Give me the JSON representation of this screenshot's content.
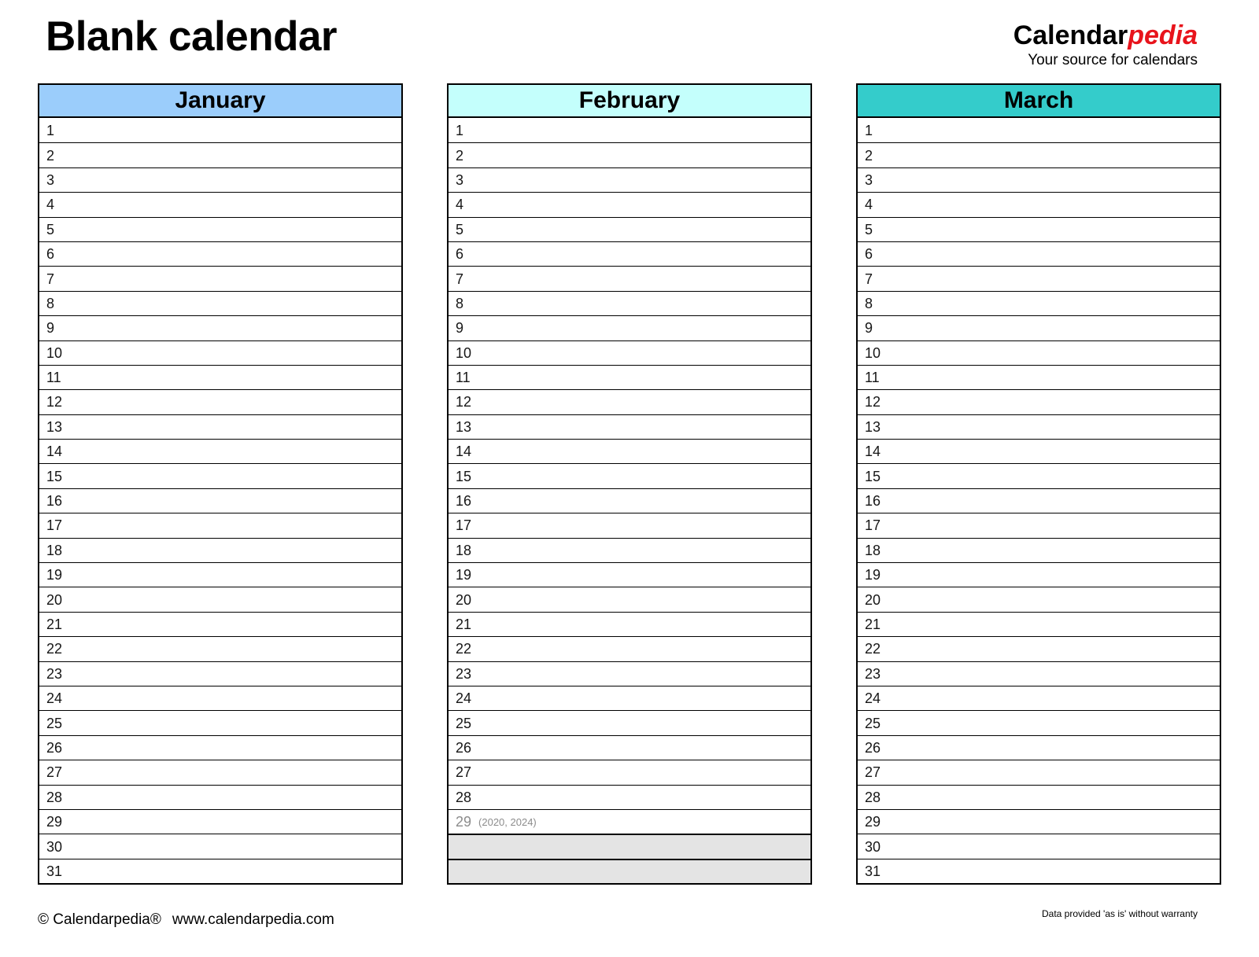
{
  "header": {
    "title": "Blank calendar",
    "brand_black": "Calendar",
    "brand_red": "pedia",
    "brand_tagline": "Your source for calendars"
  },
  "colors": {
    "january_header": "#9BCDFB",
    "february_header": "#C4FFFC",
    "march_header": "#34CCCB",
    "blank_row": "#E4E4E4",
    "brand_red": "#E8141C",
    "grid": "#000000"
  },
  "months": [
    {
      "name": "January",
      "header_color": "#9BCDFB",
      "days": [
        {
          "num": "1"
        },
        {
          "num": "2"
        },
        {
          "num": "3"
        },
        {
          "num": "4"
        },
        {
          "num": "5"
        },
        {
          "num": "6"
        },
        {
          "num": "7"
        },
        {
          "num": "8"
        },
        {
          "num": "9"
        },
        {
          "num": "10"
        },
        {
          "num": "11"
        },
        {
          "num": "12"
        },
        {
          "num": "13"
        },
        {
          "num": "14"
        },
        {
          "num": "15"
        },
        {
          "num": "16"
        },
        {
          "num": "17"
        },
        {
          "num": "18"
        },
        {
          "num": "19"
        },
        {
          "num": "20"
        },
        {
          "num": "21"
        },
        {
          "num": "22"
        },
        {
          "num": "23"
        },
        {
          "num": "24"
        },
        {
          "num": "25"
        },
        {
          "num": "26"
        },
        {
          "num": "27"
        },
        {
          "num": "28"
        },
        {
          "num": "29"
        },
        {
          "num": "30"
        },
        {
          "num": "31"
        }
      ]
    },
    {
      "name": "February",
      "header_color": "#C4FFFC",
      "days": [
        {
          "num": "1"
        },
        {
          "num": "2"
        },
        {
          "num": "3"
        },
        {
          "num": "4"
        },
        {
          "num": "5"
        },
        {
          "num": "6"
        },
        {
          "num": "7"
        },
        {
          "num": "8"
        },
        {
          "num": "9"
        },
        {
          "num": "10"
        },
        {
          "num": "11"
        },
        {
          "num": "12"
        },
        {
          "num": "13"
        },
        {
          "num": "14"
        },
        {
          "num": "15"
        },
        {
          "num": "16"
        },
        {
          "num": "17"
        },
        {
          "num": "18"
        },
        {
          "num": "19"
        },
        {
          "num": "20"
        },
        {
          "num": "21"
        },
        {
          "num": "22"
        },
        {
          "num": "23"
        },
        {
          "num": "24"
        },
        {
          "num": "25"
        },
        {
          "num": "26"
        },
        {
          "num": "27"
        },
        {
          "num": "28"
        },
        {
          "num": "29",
          "note": "(2020, 2024)",
          "leap": true
        },
        {
          "num": "",
          "blank": true
        },
        {
          "num": "",
          "blank": true
        }
      ]
    },
    {
      "name": "March",
      "header_color": "#34CCCB",
      "days": [
        {
          "num": "1"
        },
        {
          "num": "2"
        },
        {
          "num": "3"
        },
        {
          "num": "4"
        },
        {
          "num": "5"
        },
        {
          "num": "6"
        },
        {
          "num": "7"
        },
        {
          "num": "8"
        },
        {
          "num": "9"
        },
        {
          "num": "10"
        },
        {
          "num": "11"
        },
        {
          "num": "12"
        },
        {
          "num": "13"
        },
        {
          "num": "14"
        },
        {
          "num": "15"
        },
        {
          "num": "16"
        },
        {
          "num": "17"
        },
        {
          "num": "18"
        },
        {
          "num": "19"
        },
        {
          "num": "20"
        },
        {
          "num": "21"
        },
        {
          "num": "22"
        },
        {
          "num": "23"
        },
        {
          "num": "24"
        },
        {
          "num": "25"
        },
        {
          "num": "26"
        },
        {
          "num": "27"
        },
        {
          "num": "28"
        },
        {
          "num": "29"
        },
        {
          "num": "30"
        },
        {
          "num": "31"
        }
      ]
    }
  ],
  "footer": {
    "copyright": "© Calendarpedia®",
    "website": "www.calendarpedia.com",
    "disclaimer": "Data provided 'as is' without warranty"
  }
}
